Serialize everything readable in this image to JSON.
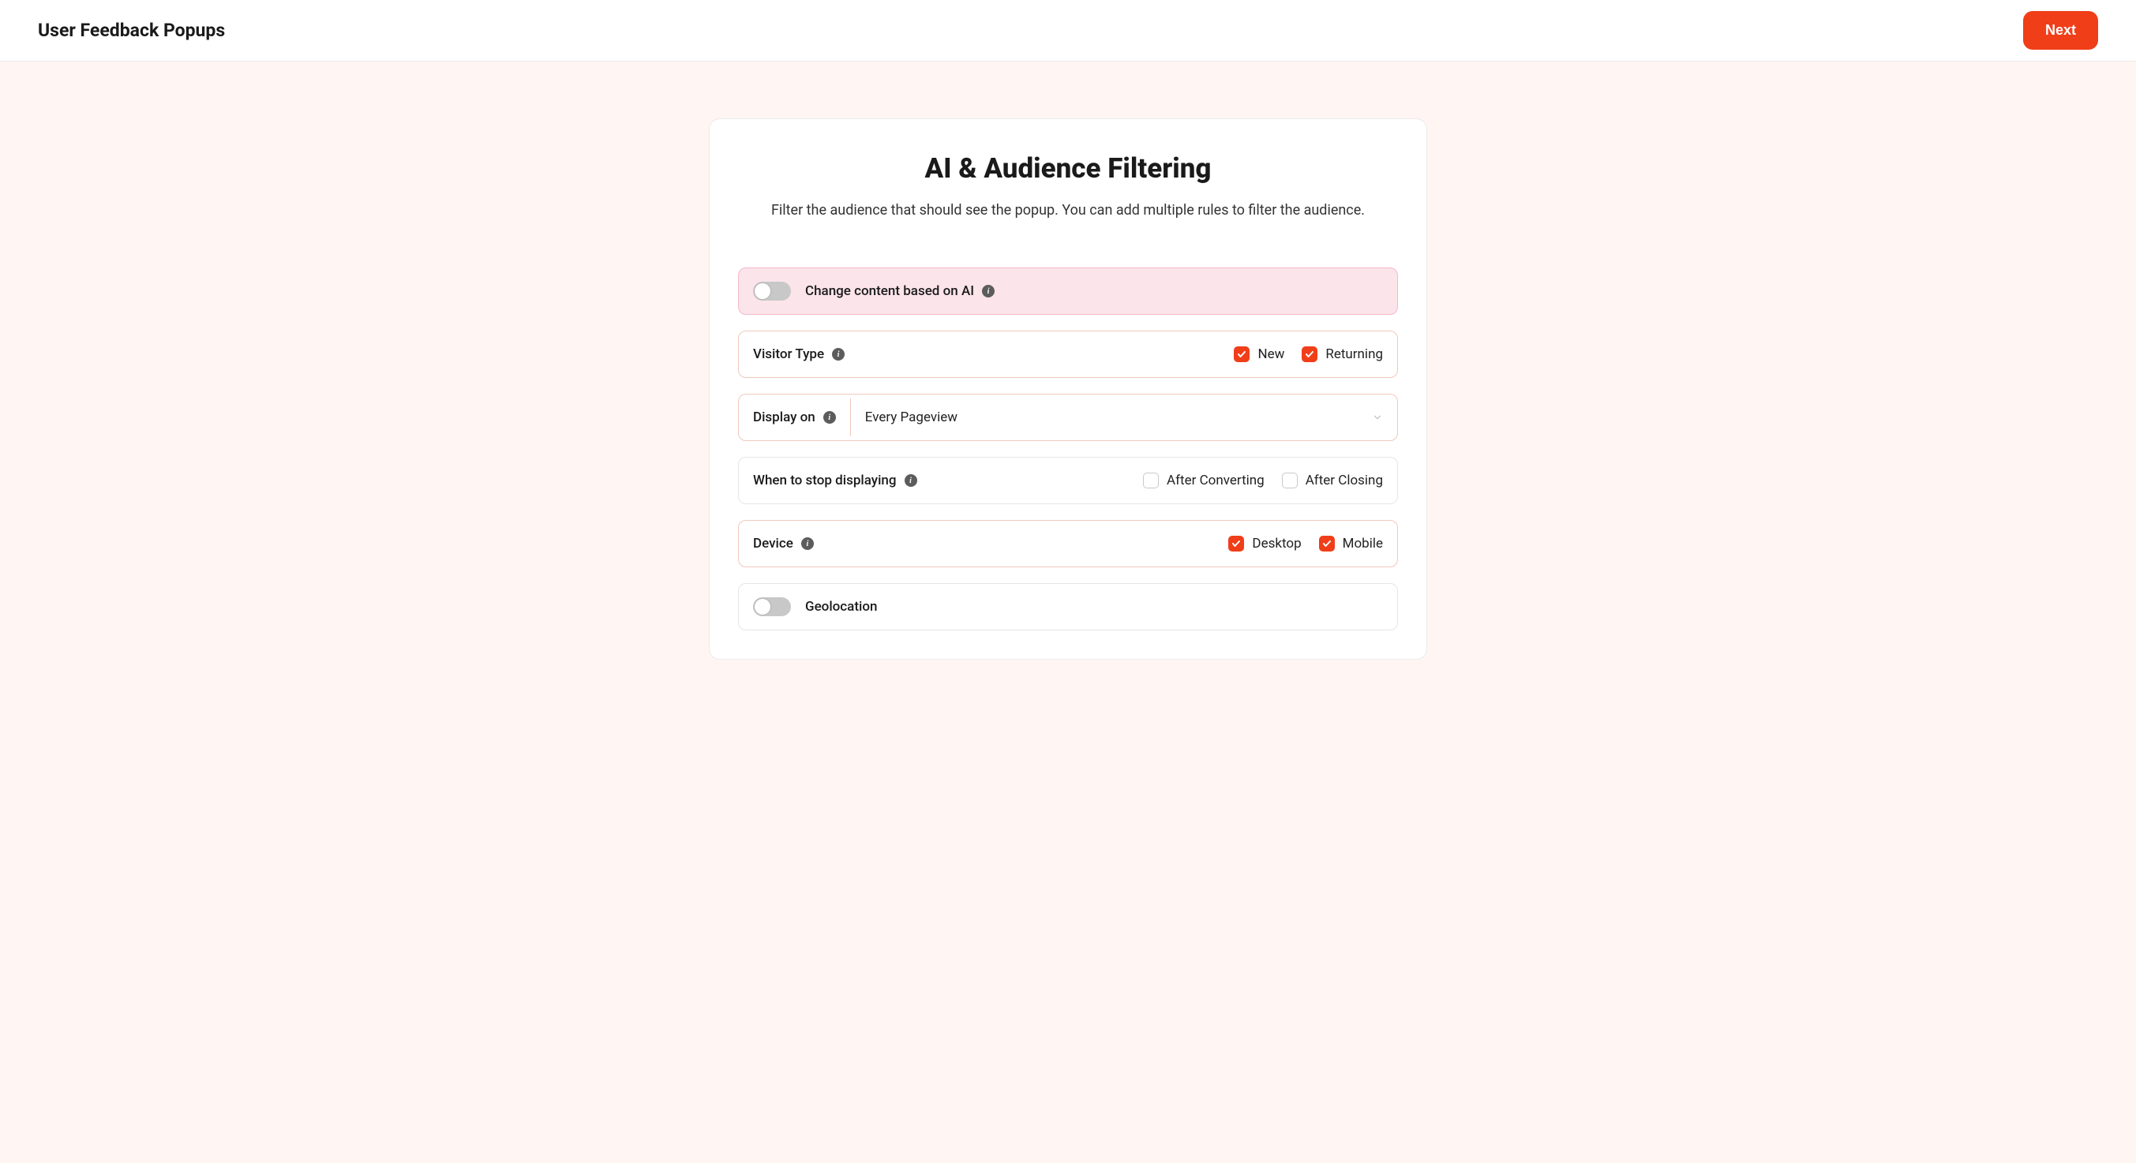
{
  "header": {
    "title": "User Feedback Popups",
    "next_label": "Next"
  },
  "card": {
    "title": "AI & Audience Filtering",
    "subtitle": "Filter the audience that should see the popup. You can add multiple rules to filter the audience."
  },
  "rules": {
    "ai": {
      "label": "Change content based on AI",
      "checked": false
    },
    "visitor_type": {
      "label": "Visitor Type",
      "options": {
        "new": {
          "label": "New",
          "checked": true
        },
        "returning": {
          "label": "Returning",
          "checked": true
        }
      }
    },
    "display_on": {
      "label": "Display on",
      "value": "Every Pageview"
    },
    "stop": {
      "label": "When to stop displaying",
      "options": {
        "after_converting": {
          "label": "After Converting",
          "checked": false
        },
        "after_closing": {
          "label": "After Closing",
          "checked": false
        }
      }
    },
    "device": {
      "label": "Device",
      "options": {
        "desktop": {
          "label": "Desktop",
          "checked": true
        },
        "mobile": {
          "label": "Mobile",
          "checked": true
        }
      }
    },
    "geolocation": {
      "label": "Geolocation",
      "checked": false
    }
  }
}
